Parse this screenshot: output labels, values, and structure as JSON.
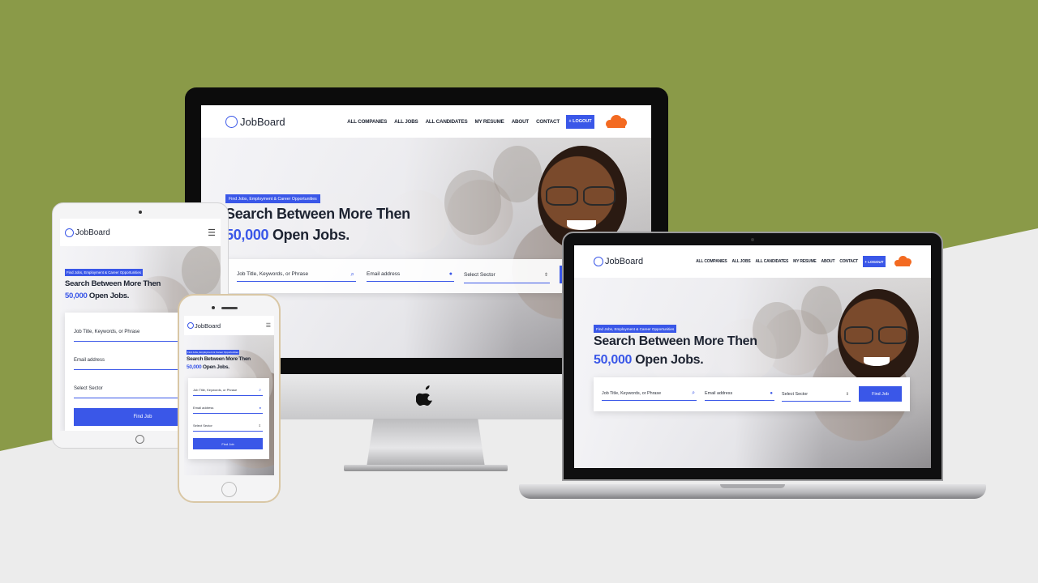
{
  "brand": {
    "name": "JobBoard",
    "logo_icon": "map-pin-circle-icon",
    "accent": "#3a57e8",
    "background_green": "#8a9a48"
  },
  "nav": {
    "items": [
      "ALL COMPANIES",
      "ALL JOBS",
      "ALL CANDIDATES",
      "MY RESUME",
      "ABOUT",
      "CONTACT"
    ],
    "logout_label": "+ LOGOUT",
    "menu_icon": "hamburger-icon",
    "cloud_icon": "soundcloud-logo"
  },
  "hero": {
    "tag": "Find Jobs, Employment & Career Opportunities",
    "headline_1": "Search Between More Then",
    "headline_2_number": "50,000",
    "headline_2_rest": " Open Jobs."
  },
  "search": {
    "keyword_placeholder": "Job Title, Keywords, or Phrase",
    "email_placeholder": "Email address",
    "sector_placeholder": "Select Sector",
    "find_button": "Find Job",
    "keyword_icon": "search-icon",
    "email_icon": "location-pin-icon",
    "sector_icon": "updown-caret-icon"
  },
  "device": {
    "imac_logo_icon": "apple-logo-icon"
  }
}
